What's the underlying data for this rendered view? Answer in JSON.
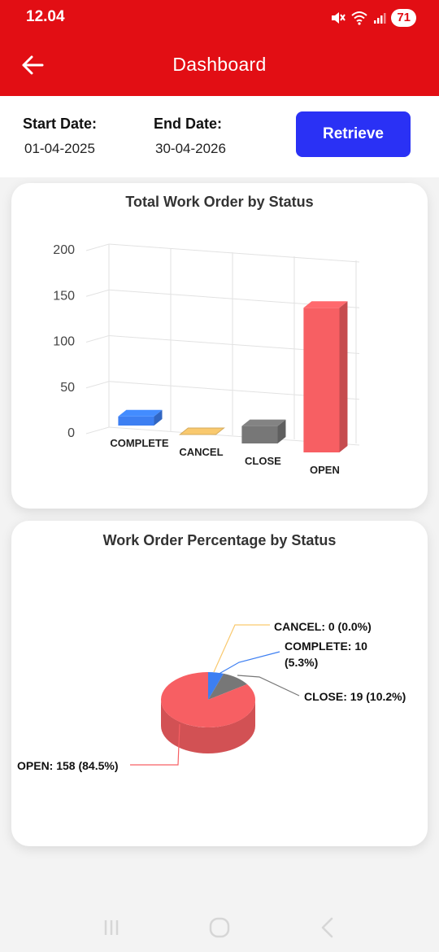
{
  "status_bar": {
    "time": "12.04",
    "battery": "71",
    "icons": [
      "mute-icon",
      "wifi-icon",
      "signal-icon",
      "battery-icon"
    ]
  },
  "app_bar": {
    "title": "Dashboard",
    "back_icon": "arrow-left-icon"
  },
  "filters": {
    "start_label": "Start Date:",
    "start_value": "01-04-2025",
    "end_label": "End Date:",
    "end_value": "30-04-2026",
    "retrieve_label": "Retrieve"
  },
  "colors": {
    "accent": "#e20e14",
    "button": "#2a31f5",
    "complete": "#3d7ff2",
    "cancel": "#f9c96e",
    "close": "#777777",
    "open": "#f75f63"
  },
  "chart_data": [
    {
      "type": "bar",
      "title": "Total Work Order by Status",
      "categories": [
        "COMPLETE",
        "CANCEL",
        "CLOSE",
        "OPEN"
      ],
      "values": [
        10,
        0,
        19,
        158
      ],
      "colors": [
        "#3d7ff2",
        "#f9c96e",
        "#777777",
        "#f75f63"
      ],
      "yticks": [
        "0",
        "50",
        "100",
        "150",
        "200"
      ],
      "ylim": [
        0,
        200
      ],
      "grid": true,
      "style": "3d"
    },
    {
      "type": "pie",
      "title": "Work Order Percentage by Status",
      "labels": [
        "OPEN",
        "COMPLETE",
        "CLOSE",
        "CANCEL"
      ],
      "values": [
        158,
        10,
        19,
        0
      ],
      "percent": [
        84.5,
        5.3,
        10.2,
        0.0
      ],
      "colors": [
        "#f75f63",
        "#3d7ff2",
        "#777777",
        "#f9c96e"
      ],
      "slice_labels": {
        "cancel": "CANCEL: 0 (0.0%)",
        "complete_1": "COMPLETE: 10",
        "complete_2": "(5.3%)",
        "close": "CLOSE: 19 (10.2%)",
        "open": "OPEN: 158 (84.5%)"
      },
      "style": "3d"
    }
  ],
  "nav_bar": {
    "icons": [
      "recent-apps-icon",
      "home-icon",
      "back-nav-icon"
    ]
  }
}
